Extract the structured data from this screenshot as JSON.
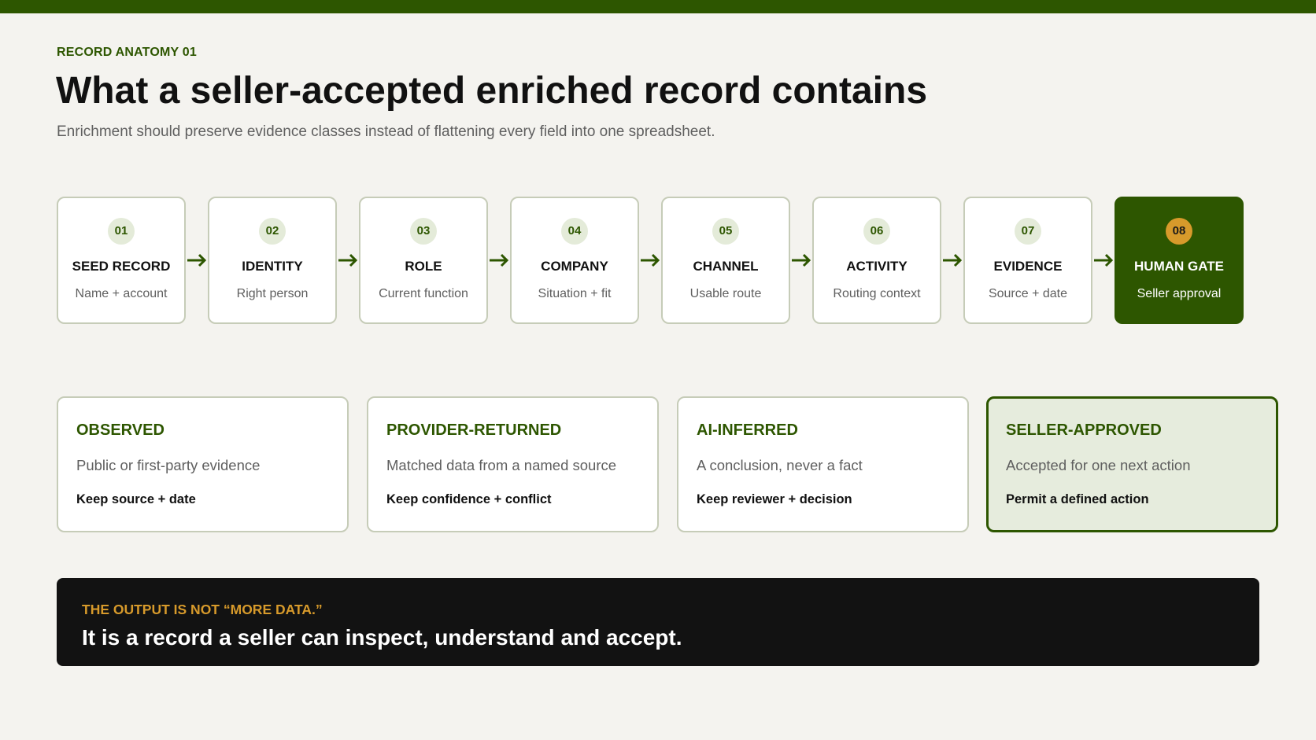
{
  "header": {
    "eyebrow": "RECORD ANATOMY 01",
    "title": "What a seller-accepted enriched record contains",
    "subtitle": "Enrichment should preserve evidence classes instead of flattening every field into one spreadsheet."
  },
  "steps": [
    {
      "num": "01",
      "name": "SEED RECORD",
      "desc": "Name + account"
    },
    {
      "num": "02",
      "name": "IDENTITY",
      "desc": "Right person"
    },
    {
      "num": "03",
      "name": "ROLE",
      "desc": "Current function"
    },
    {
      "num": "04",
      "name": "COMPANY",
      "desc": "Situation + fit"
    },
    {
      "num": "05",
      "name": "CHANNEL",
      "desc": "Usable route"
    },
    {
      "num": "06",
      "name": "ACTIVITY",
      "desc": "Routing context"
    },
    {
      "num": "07",
      "name": "EVIDENCE",
      "desc": "Source + date"
    },
    {
      "num": "08",
      "name": "HUMAN GATE",
      "desc": "Seller approval"
    }
  ],
  "classes": [
    {
      "title": "OBSERVED",
      "desc": "Public or first-party evidence",
      "action": "Keep source + date"
    },
    {
      "title": "PROVIDER-RETURNED",
      "desc": "Matched data from a named source",
      "action": "Keep confidence + conflict"
    },
    {
      "title": "AI-INFERRED",
      "desc": "A conclusion, never a fact",
      "action": "Keep reviewer + decision"
    },
    {
      "title": "SELLER-APPROVED",
      "desc": "Accepted for one next action",
      "action": "Permit a defined action"
    }
  ],
  "callout": {
    "kicker": "THE OUTPUT IS NOT “MORE DATA.”",
    "statement": "It is a record a seller can inspect, understand and accept."
  },
  "colors": {
    "brand_green": "#2d5600",
    "accent_amber": "#d79a2b",
    "background": "#f4f3ef",
    "callout_bg": "#121212"
  },
  "icons": {
    "connector": "arrow-right-icon"
  }
}
